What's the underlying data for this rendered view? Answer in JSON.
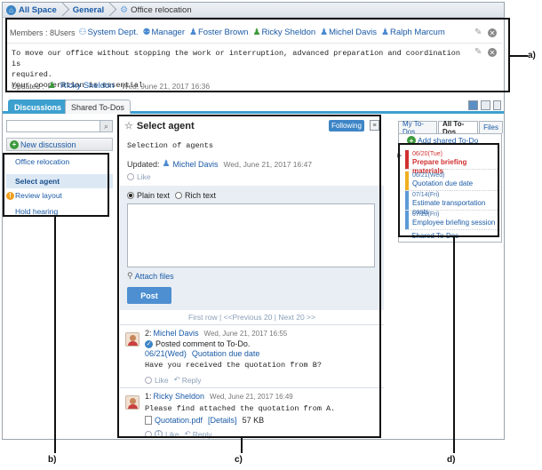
{
  "breadcrumb": {
    "space": "All Space",
    "group": "General",
    "current": "Office relocation"
  },
  "members": {
    "label": "Members : 8Users",
    "list": [
      {
        "name": "System Dept.",
        "icon": "group-icon"
      },
      {
        "name": "Manager",
        "icon": "role-icon"
      },
      {
        "name": "Foster Brown",
        "icon": "user-icon"
      },
      {
        "name": "Ricky Sheldon",
        "icon": "user-green-icon"
      },
      {
        "name": "Michel Davis",
        "icon": "user-icon"
      },
      {
        "name": "Ralph Marcum",
        "icon": "user-icon"
      }
    ]
  },
  "description": {
    "lines": [
      "To move our office without stopping the work or interruption, advanced preparation and coordination is",
      "required.",
      "Your cooperation is essential."
    ],
    "updated_label": "Updated :",
    "updated_by": "Ricky Sheldon",
    "updated_at": "Wed, June 21, 2017 16:36"
  },
  "tabs": {
    "discussions": "Discussions",
    "shared_todos": "Shared To-Dos"
  },
  "left": {
    "new_discussion": "New discussion",
    "items": [
      {
        "label": "Office relocation",
        "selected": false,
        "warn": false
      },
      {
        "label": "Select agent",
        "selected": true,
        "warn": false
      },
      {
        "label": "Review layout",
        "selected": false,
        "warn": true
      },
      {
        "label": "Hold hearing",
        "selected": false,
        "warn": false
      }
    ]
  },
  "discussion": {
    "title": "Select agent",
    "follow_label": "Following",
    "body": "Selection of agents",
    "updated_label": "Updated:",
    "updated_by": "Michel Davis",
    "updated_at": "Wed, June 21, 2017 16:47",
    "like": "Like",
    "plain_text": "Plain text",
    "rich_text": "Rich text",
    "attach_files": "Attach files",
    "post": "Post",
    "pager": {
      "first": "First row",
      "prev": "<<Previous 20",
      "next": "Next 20 >>",
      "sep": "|"
    }
  },
  "comments": [
    {
      "num": "2:",
      "author": "Michel Davis",
      "time": "Wed, June 21, 2017 16:55",
      "action": "Posted comment to To-Do.",
      "todo_date": "06/21(Wed)",
      "todo_title": "Quotation due date",
      "text": "Have you received the quotation from B?",
      "like": "Like",
      "reply": "Reply"
    },
    {
      "num": "1:",
      "author": "Ricky Sheldon",
      "time": "Wed, June 21, 2017 16:49",
      "text": "Please find attached the quotation from A.",
      "file": "Quotation.pdf",
      "details": "[Details]",
      "size": "57 KB",
      "like_count": "1",
      "like": "Like",
      "reply": "Reply"
    }
  ],
  "right": {
    "tabs": [
      "My To-Dos",
      "All To-Dos",
      "Files"
    ],
    "add": "Add shared To-Do",
    "todos": [
      {
        "date": "06/20(Tue)",
        "title": "Prepare briefing materials",
        "color": "#d03030",
        "urgent": true
      },
      {
        "date": "06/21(Wed)",
        "title": "Quotation due date",
        "color": "#f0b020",
        "urgent": false
      },
      {
        "date": "07/14(Fri)",
        "title": "Estimate transportation costs",
        "color": "#5b9ad6",
        "urgent": false
      },
      {
        "date": "07/28(Fri)",
        "title": "Employee briefing session",
        "color": "#5b9ad6",
        "urgent": false
      }
    ],
    "shared": "Shared To-Dos"
  },
  "annotations": {
    "a": "a)",
    "b": "b)",
    "c": "c)",
    "d": "d)"
  },
  "colors": {
    "accent": "#3ca0cf",
    "link": "#1a5aa6",
    "post_button": "#4d8fd1"
  }
}
